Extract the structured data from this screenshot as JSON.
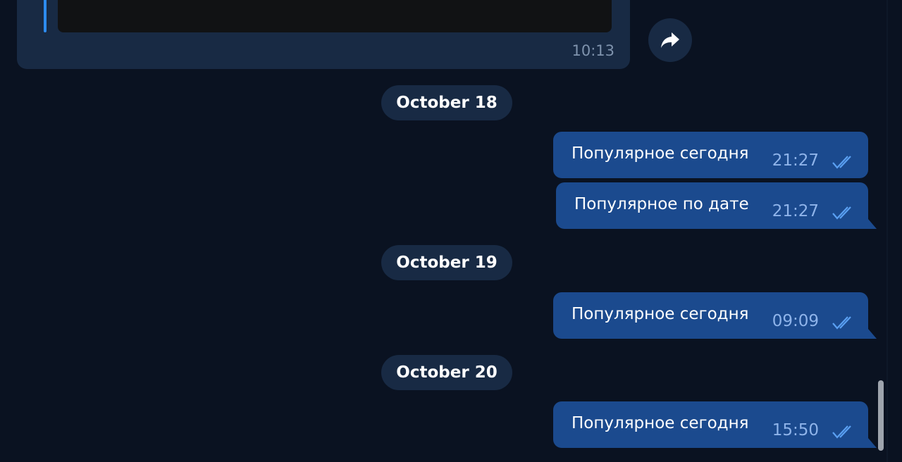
{
  "colors": {
    "background": "#0a1221",
    "incoming_bubble": "#182a44",
    "outgoing_bubble": "#1b4a8e",
    "accent": "#2d8cf0",
    "outgoing_time": "#8fb4ea"
  },
  "incoming_message": {
    "time": "10:13"
  },
  "forward_button": {
    "icon": "forward-arrow-icon"
  },
  "date_separators": [
    "October 18",
    "October 19",
    "October 20"
  ],
  "outgoing_messages": [
    {
      "text": "Популярное сегодня",
      "time": "21:27",
      "status_icon": "double-check-icon"
    },
    {
      "text": "Популярное по дате",
      "time": "21:27",
      "status_icon": "double-check-icon"
    },
    {
      "text": "Популярное сегодня",
      "time": "09:09",
      "status_icon": "double-check-icon"
    },
    {
      "text": "Популярное сегодня",
      "time": "15:50",
      "status_icon": "double-check-icon"
    }
  ]
}
